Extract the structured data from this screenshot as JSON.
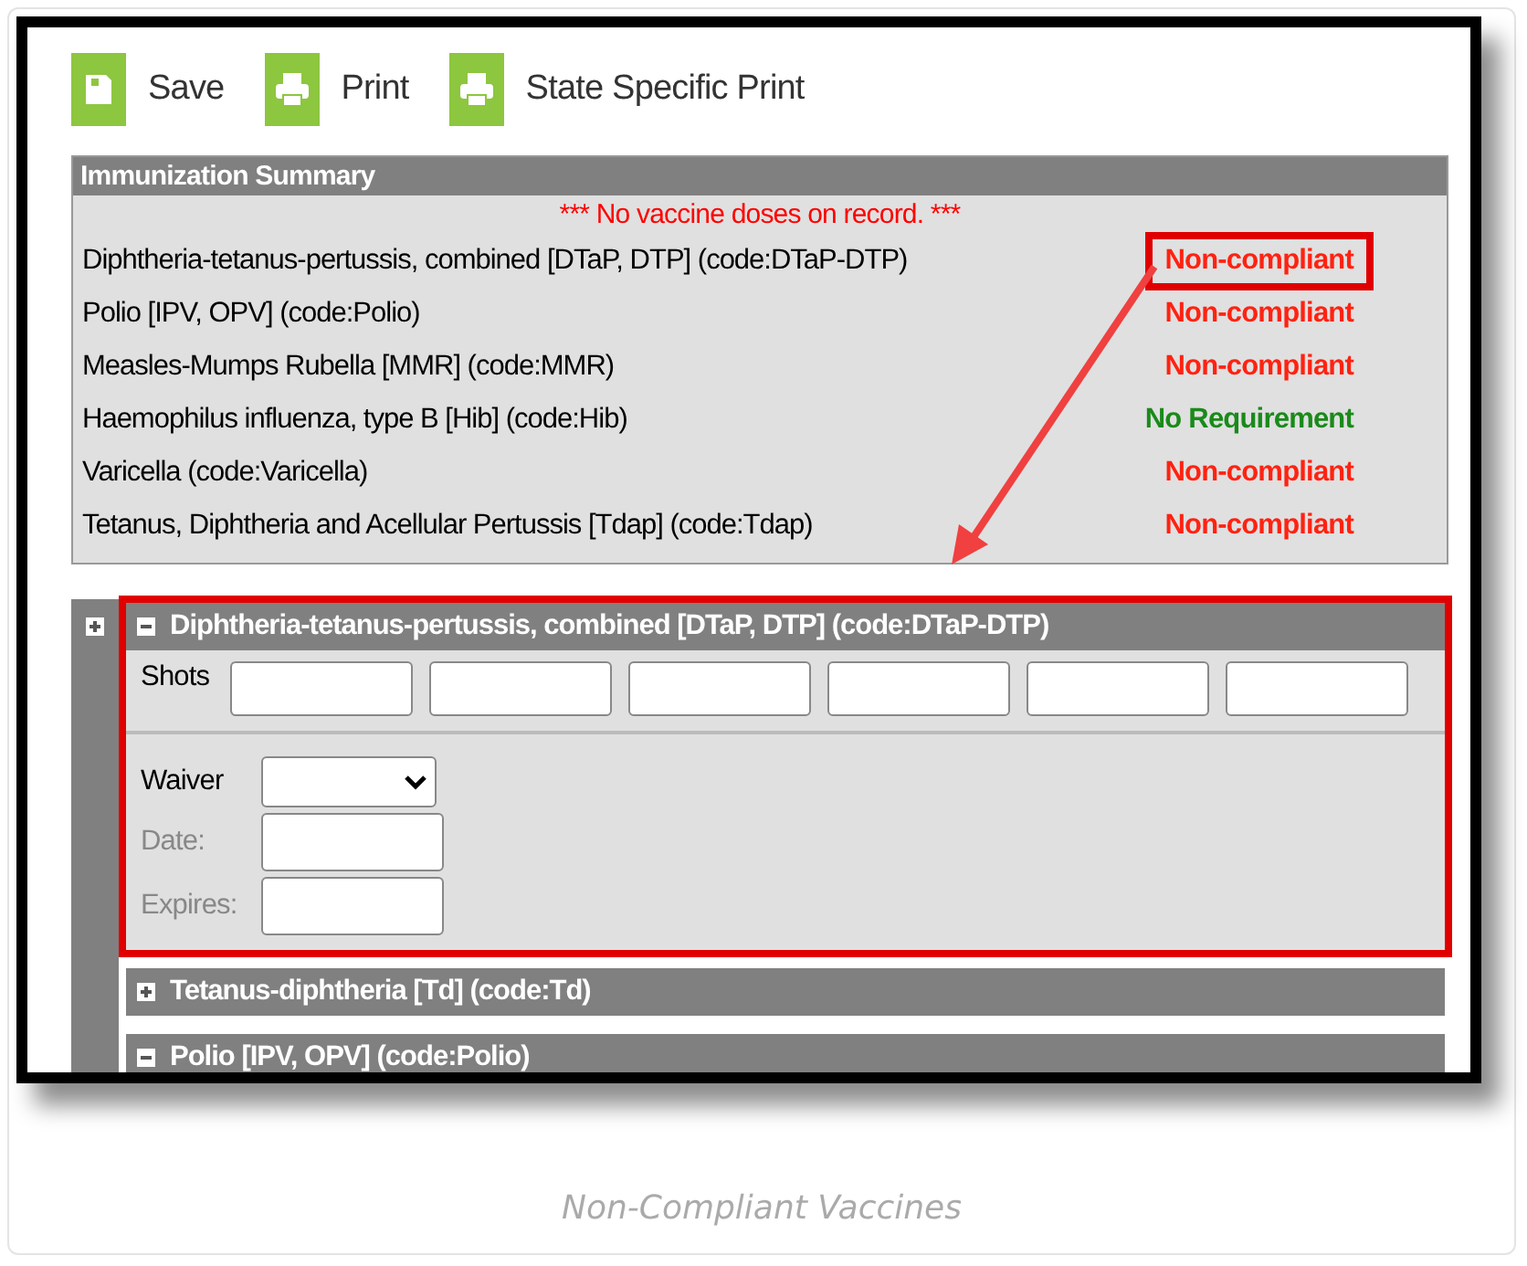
{
  "toolbar": [
    {
      "kind": "save",
      "label": "Save"
    },
    {
      "kind": "print",
      "label": "Print"
    },
    {
      "kind": "print",
      "label": "State Specific Print"
    }
  ],
  "summary": {
    "title": "Immunization Summary",
    "message": "*** No vaccine doses on record. ***",
    "rows": [
      {
        "vaccine": "Diphtheria-tetanus-pertussis, combined [DTaP, DTP] (code:DTaP-DTP)",
        "status": "Non-compliant",
        "kind": "non_compliant",
        "highlighted": true
      },
      {
        "vaccine": "Polio [IPV, OPV] (code:Polio)",
        "status": "Non-compliant",
        "kind": "non_compliant",
        "highlighted": false
      },
      {
        "vaccine": "Measles-Mumps Rubella [MMR] (code:MMR)",
        "status": "Non-compliant",
        "kind": "non_compliant",
        "highlighted": false
      },
      {
        "vaccine": "Haemophilus influenza, type B [Hib] (code:Hib)",
        "status": "No Requirement",
        "kind": "no_requirement",
        "highlighted": false
      },
      {
        "vaccine": "Varicella (code:Varicella)",
        "status": "Non-compliant",
        "kind": "non_compliant",
        "highlighted": false
      },
      {
        "vaccine": "Tetanus, Diphtheria and Acellular Pertussis [Tdap] (code:Tdap)",
        "status": "Non-compliant",
        "kind": "non_compliant",
        "highlighted": false
      }
    ]
  },
  "outline_expanded": false,
  "sections": [
    {
      "title": "Diphtheria-tetanus-pertussis, combined [DTaP, DTP] (code:DTaP-DTP)",
      "expanded": true,
      "highlighted": true,
      "shots_label": "Shots",
      "shots": [
        {
          "kind": "input"
        },
        {
          "kind": "input"
        },
        {
          "kind": "input"
        },
        {
          "kind": "input"
        },
        {
          "kind": "input"
        },
        {
          "kind": "input"
        }
      ],
      "waiver": {
        "label": "Waiver",
        "disabled": false
      },
      "date": {
        "label": "Date:",
        "disabled": true
      },
      "expires": {
        "label": "Expires:",
        "disabled": true
      }
    },
    {
      "title": "Tetanus-diphtheria [Td] (code:Td)",
      "expanded": false,
      "highlighted": false
    },
    {
      "title": "Polio [IPV, OPV] (code:Polio)",
      "expanded": true,
      "highlighted": false
    }
  ],
  "caption": "Non-Compliant Vaccines"
}
